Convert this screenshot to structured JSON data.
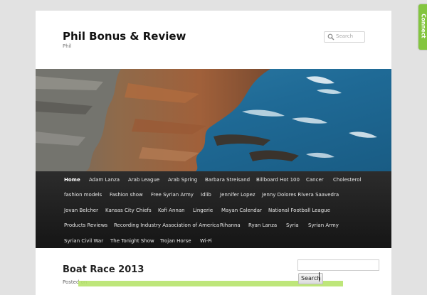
{
  "site": {
    "title": "Phil Bonus & Review",
    "description": "Phil"
  },
  "search": {
    "placeholder": "Search"
  },
  "nav": {
    "items": [
      {
        "label": "Home",
        "current": true
      },
      {
        "label": "Adam Lanza"
      },
      {
        "label": "Arab League"
      },
      {
        "label": "Arab Spring"
      },
      {
        "label": "Barbara Streisand"
      },
      {
        "label": "Billboard Hot 100"
      },
      {
        "label": "Cancer"
      },
      {
        "label": "Cholesterol"
      },
      {
        "label": "fashion models"
      },
      {
        "label": "Fashion show"
      },
      {
        "label": "Free Syrian Army"
      },
      {
        "label": "Idlib"
      },
      {
        "label": "Jennifer Lopez"
      },
      {
        "label": "Jenny Dolores Rivera Saavedra"
      },
      {
        "label": "Jovan Belcher"
      },
      {
        "label": "Kansas City Chiefs"
      },
      {
        "label": "Kofi Annan"
      },
      {
        "label": "Lingerie"
      },
      {
        "label": "Mayan Calendar"
      },
      {
        "label": "National Football League"
      },
      {
        "label": "Products Reviews"
      },
      {
        "label": "Recording Industry Association of America"
      },
      {
        "label": "Rihanna"
      },
      {
        "label": "Ryan Lanza"
      },
      {
        "label": "Syria"
      },
      {
        "label": "Syrian Army"
      },
      {
        "label": "Syrian Civil War"
      },
      {
        "label": "The Tonight Show"
      },
      {
        "label": "Trojan Horse"
      },
      {
        "label": "Wi-Fi"
      }
    ]
  },
  "post": {
    "title": "Boat Race 2013",
    "meta": "Posted on"
  },
  "sidebar": {
    "search_button": "Search"
  },
  "connect_tab": {
    "label": "Connect"
  },
  "colors": {
    "nav_bg": "#1f1f1f",
    "connect_green": "#83c53f",
    "highlight": "#b7e36b"
  }
}
